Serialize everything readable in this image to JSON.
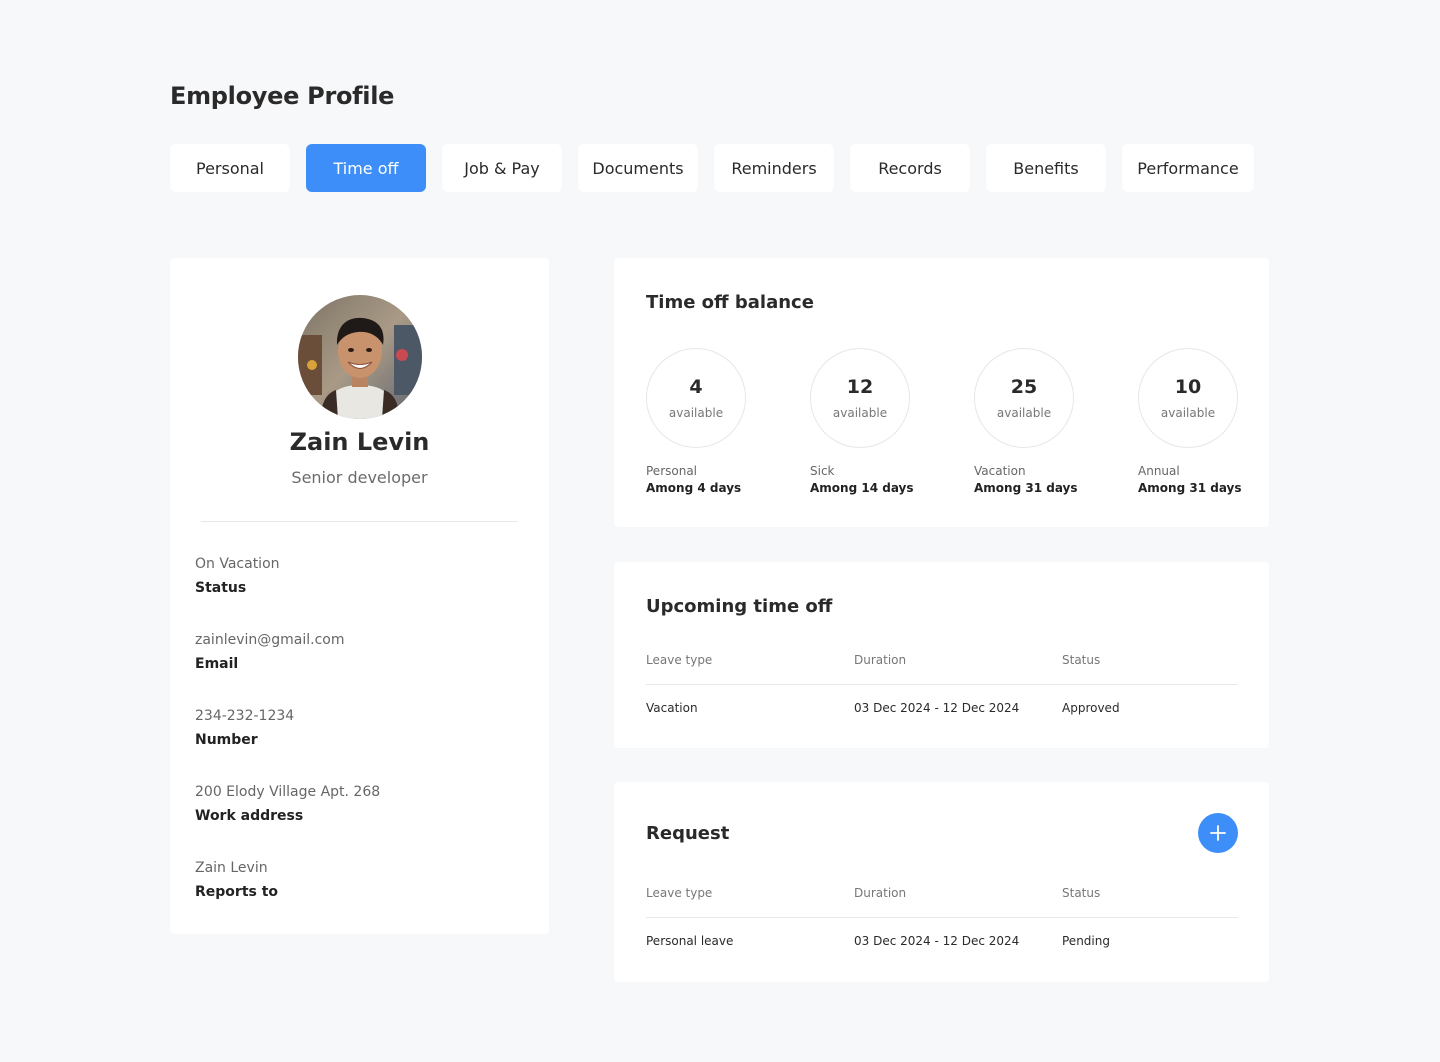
{
  "page": {
    "title": "Employee Profile"
  },
  "tabs": [
    {
      "label": "Personal"
    },
    {
      "label": "Time off",
      "active": true
    },
    {
      "label": "Job & Pay"
    },
    {
      "label": "Documents"
    },
    {
      "label": "Reminders"
    },
    {
      "label": "Records"
    },
    {
      "label": "Benefits"
    },
    {
      "label": "Performance"
    }
  ],
  "profile": {
    "name": "Zain Levin",
    "role": "Senior developer",
    "fields": [
      {
        "value": "On Vacation",
        "label": "Status"
      },
      {
        "value": "zainlevin@gmail.com",
        "label": "Email"
      },
      {
        "value": "234-232-1234",
        "label": "Number"
      },
      {
        "value": "200 Elody Village Apt. 268",
        "label": "Work address"
      },
      {
        "value": "Zain Levin",
        "label": "Reports to"
      }
    ]
  },
  "balance": {
    "title": "Time off balance",
    "items": [
      {
        "count": "4",
        "available_label": "available",
        "type": "Personal",
        "among": "Among 4 days"
      },
      {
        "count": "12",
        "available_label": "available",
        "type": "Sick",
        "among": "Among 14 days"
      },
      {
        "count": "25",
        "available_label": "available",
        "type": "Vacation",
        "among": "Among 31 days"
      },
      {
        "count": "10",
        "available_label": "available",
        "type": "Annual",
        "among": "Among 31 days"
      }
    ]
  },
  "upcoming": {
    "title": "Upcoming time off",
    "columns": [
      "Leave type",
      "Duration",
      "Status"
    ],
    "rows": [
      {
        "leave_type": "Vacation",
        "duration": "03 Dec 2024 - 12 Dec 2024",
        "status": "Approved"
      }
    ]
  },
  "request": {
    "title": "Request",
    "add_icon": "plus-icon",
    "columns": [
      "Leave type",
      "Duration",
      "Status"
    ],
    "rows": [
      {
        "leave_type": "Personal leave",
        "duration": "03 Dec 2024 - 12 Dec 2024",
        "status": "Pending"
      }
    ]
  },
  "colors": {
    "accent": "#3d8ef8",
    "background": "#f7f8fa",
    "card": "#ffffff"
  }
}
